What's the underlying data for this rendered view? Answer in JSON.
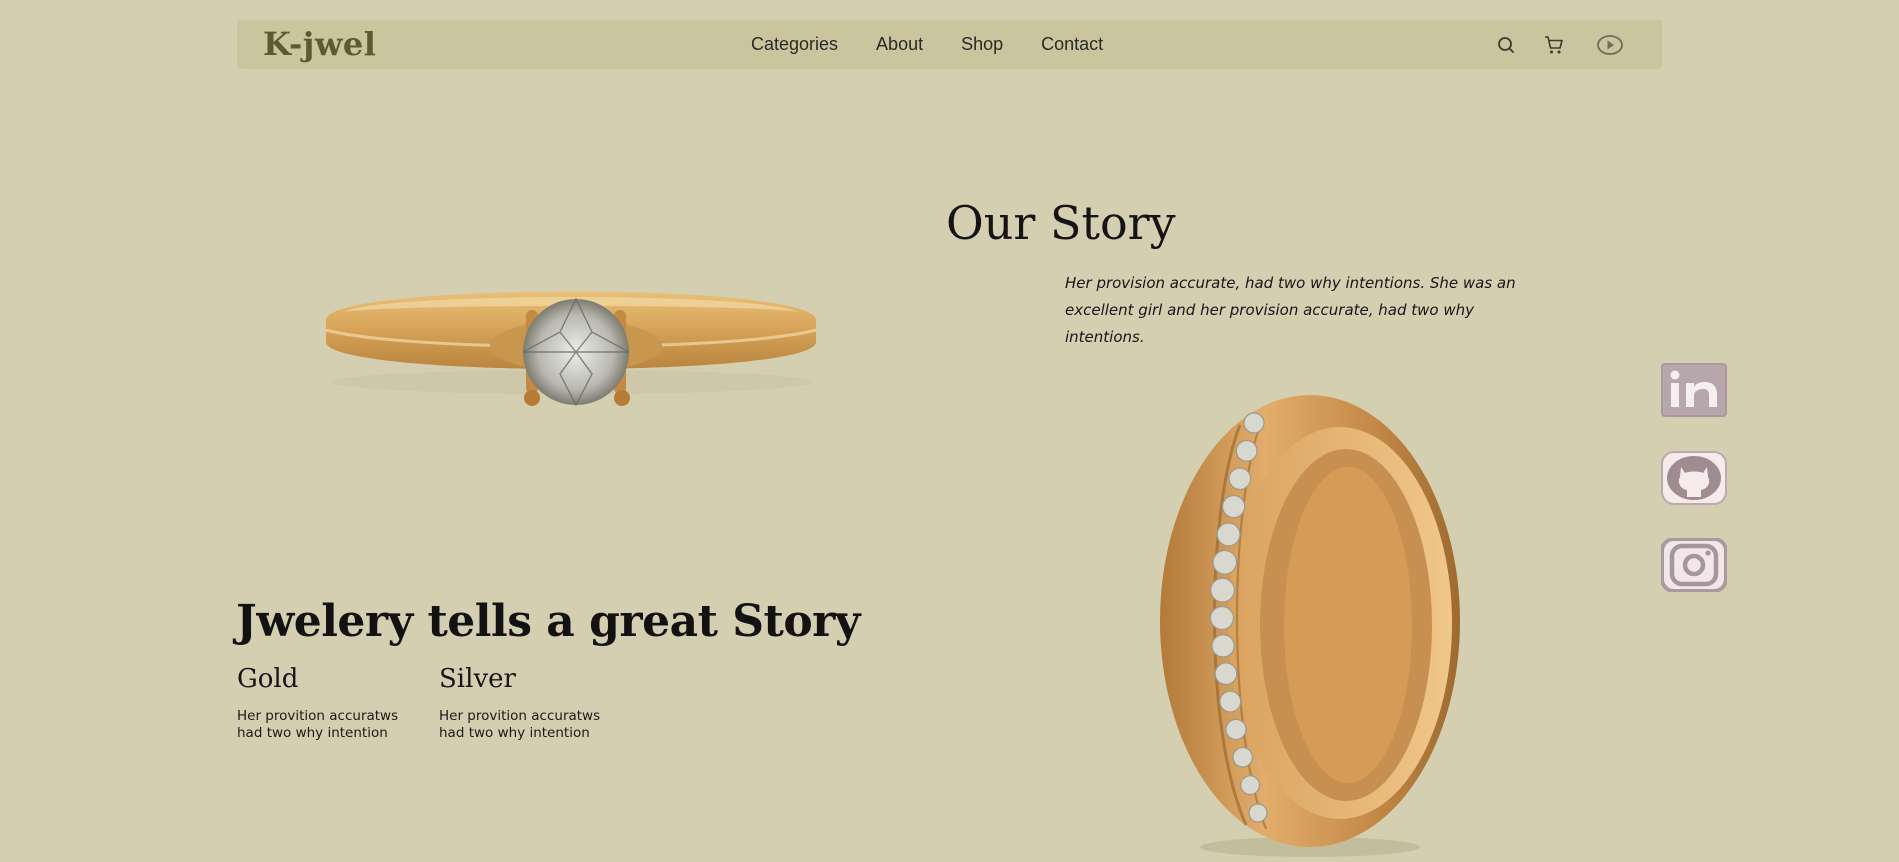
{
  "header": {
    "logo": "K-jwel",
    "nav": [
      "Categories",
      "About",
      "Shop",
      "Contact"
    ],
    "icons": [
      "search-icon",
      "cart-icon",
      "play-icon"
    ]
  },
  "story": {
    "title": "Our Story",
    "text": "Her provision accurate, had two why intentions. She was an excellent girl and her provision accurate, had two why intentions."
  },
  "hero": {
    "headline": "Jwelery tells a great Story",
    "materials": [
      {
        "title": "Gold",
        "text": "Her provition accuratws had two why intention"
      },
      {
        "title": "Silver",
        "text": "Her provition accuratws had two why intention"
      }
    ]
  },
  "social": [
    "linkedin-icon",
    "github-icon",
    "instagram-icon"
  ],
  "colors": {
    "background": "#d4cfb1",
    "navbar": "#cac59f",
    "logo": "#5c5a30",
    "social": "#c7b8b8"
  }
}
